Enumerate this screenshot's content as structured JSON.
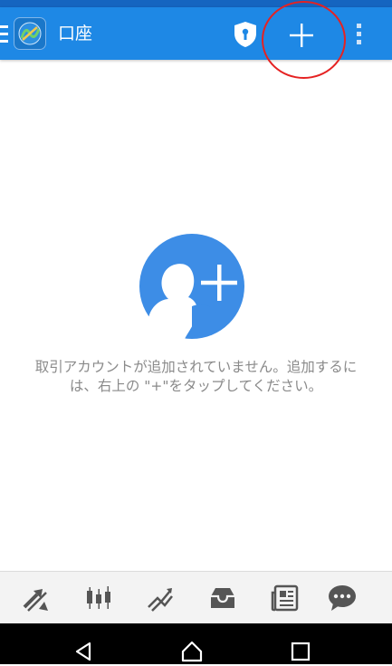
{
  "app_bar": {
    "title": "口座",
    "background": "#1e88e5",
    "icons": [
      "hamburger-icon",
      "app-logo",
      "shield-icon",
      "plus-icon",
      "more-vertical-icon"
    ]
  },
  "annotation": {
    "color": "#e52222",
    "target": "add-account-button"
  },
  "empty_state": {
    "icon": "add-person-icon",
    "icon_color": "#3d8de6",
    "line1": "取引アカウントが追加されていません。追加するに",
    "line2": "は、右上の \"+\"をタップしてください。"
  },
  "bottom_nav": {
    "icon_color": "#555555",
    "items": [
      "quotes-icon",
      "chart-icon",
      "trade-icon",
      "history-icon",
      "news-icon",
      "chat-icon"
    ]
  },
  "system_nav": {
    "items": [
      "back-icon",
      "home-icon",
      "recents-icon"
    ]
  }
}
